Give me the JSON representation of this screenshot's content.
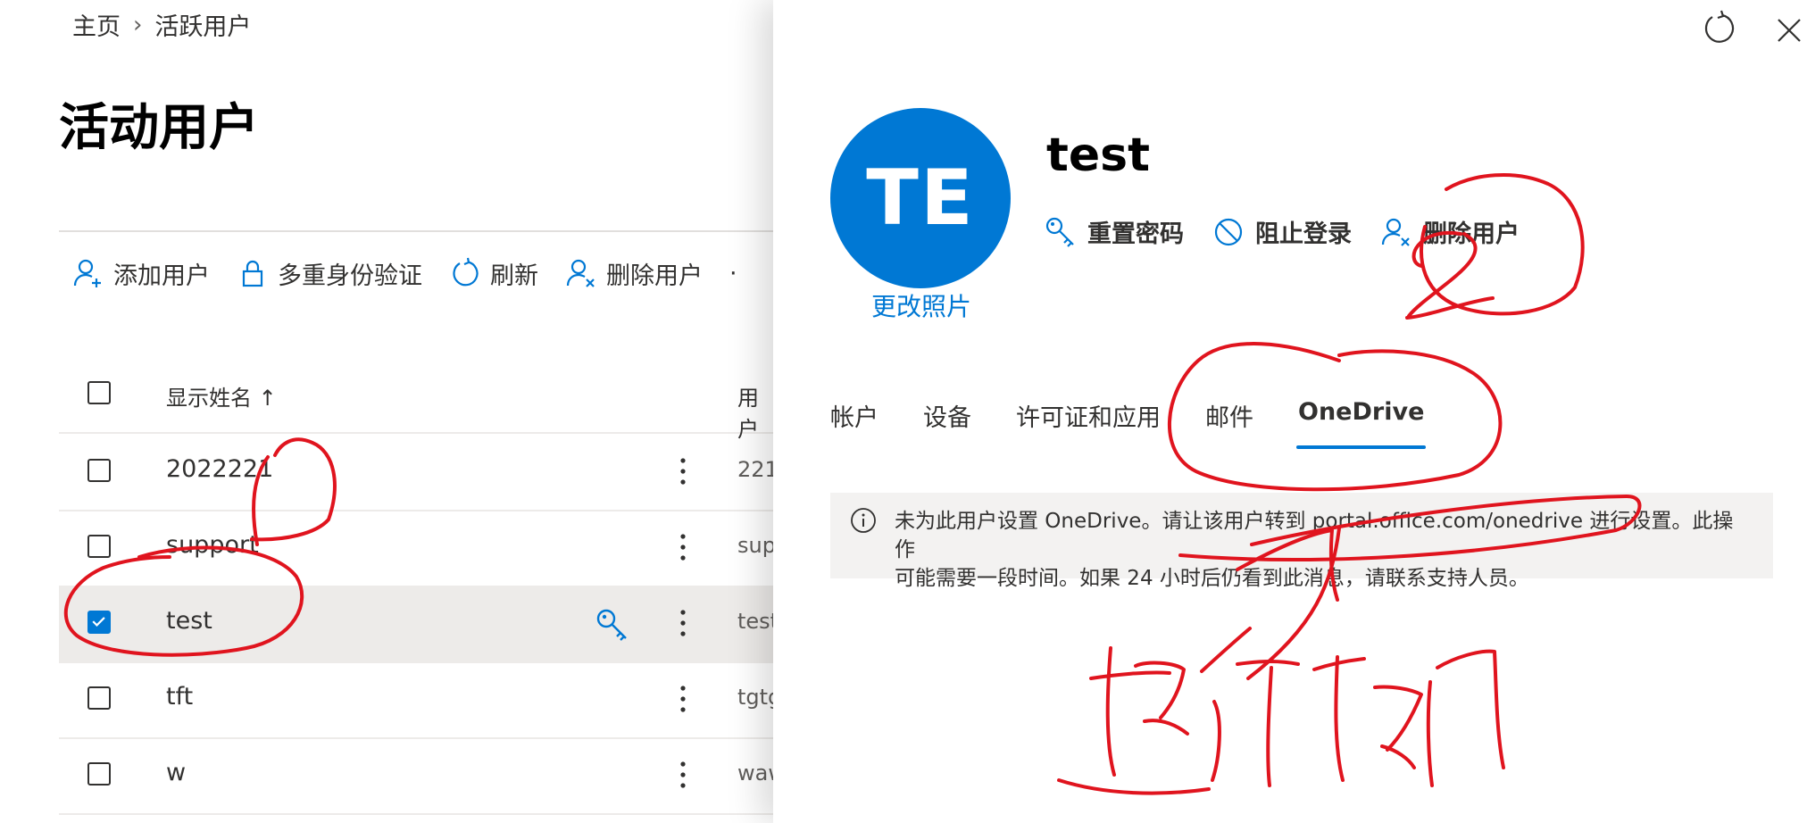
{
  "breadcrumb": {
    "home": "主页",
    "separator": "›",
    "current": "活跃用户"
  },
  "page_title": "活动用户",
  "toolbar": {
    "add_user": "添加用户",
    "mfa": "多重身份验证",
    "refresh": "刷新",
    "delete_user": "删除用户",
    "more": "·"
  },
  "grid": {
    "col_display_name": "显示姓名 ↑",
    "col_username": "用户",
    "rows": [
      {
        "name": "2022221",
        "username": "221",
        "selected": false,
        "key_icon": false
      },
      {
        "name": "support",
        "username": "sup",
        "selected": false,
        "key_icon": false
      },
      {
        "name": "test",
        "username": "test",
        "selected": true,
        "key_icon": true
      },
      {
        "name": "tft",
        "username": "tgtg",
        "selected": false,
        "key_icon": false
      },
      {
        "name": "w",
        "username": "waw",
        "selected": false,
        "key_icon": false
      }
    ]
  },
  "panel": {
    "avatar_initials": "TE",
    "change_photo": "更改照片",
    "user_name": "test",
    "actions": {
      "reset_password": "重置密码",
      "block_signin": "阻止登录",
      "delete_user": "删除用户"
    },
    "tabs": [
      "帐户",
      "设备",
      "许可证和应用",
      "邮件",
      "OneDrive"
    ],
    "active_tab": "OneDrive",
    "info_line1": "未为此用户设置 OneDrive。请让该用户转到 portal.office.com/onedrive 进行设置。此操作",
    "info_line2": "可能需要一段时间。如果 24 小时后仍看到此消息，请联系支持人员。"
  },
  "colors": {
    "accent": "#0078d4",
    "annotation": "#e0141e",
    "selected_row": "#edebe9",
    "info_bg": "#f3f2f1"
  },
  "icons": [
    "add-user-icon",
    "lock-icon",
    "refresh-icon",
    "delete-user-icon",
    "key-icon",
    "more-vertical-icon",
    "block-icon",
    "info-icon",
    "close-icon"
  ]
}
